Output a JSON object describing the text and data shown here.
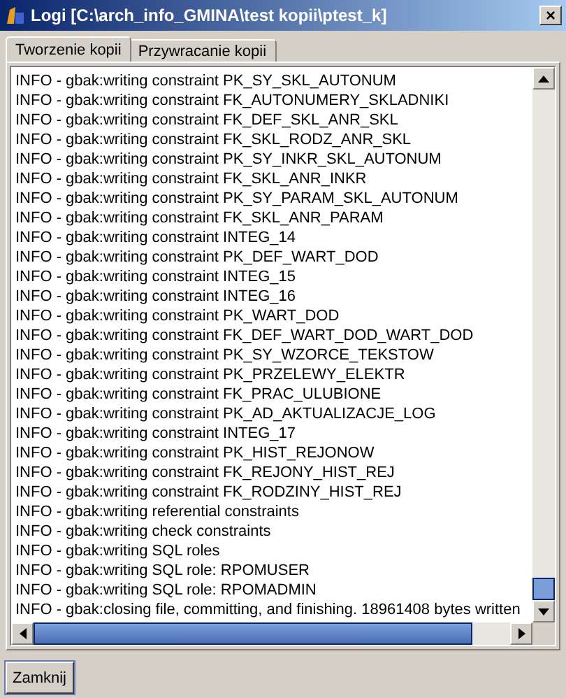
{
  "window": {
    "title": "Logi [C:\\arch_info_GMINA\\test kopii\\ptest_k]",
    "close": "×"
  },
  "tabs": [
    {
      "label": "Tworzenie kopii",
      "selected": true
    },
    {
      "label": "Przywracanie kopii",
      "selected": false
    }
  ],
  "log_lines": [
    "INFO - gbak:writing constraint PK_SY_SKL_AUTONUM",
    "INFO - gbak:writing constraint FK_AUTONUMERY_SKLADNIKI",
    "INFO - gbak:writing constraint FK_DEF_SKL_ANR_SKL",
    "INFO - gbak:writing constraint FK_SKL_RODZ_ANR_SKL",
    "INFO - gbak:writing constraint PK_SY_INKR_SKL_AUTONUM",
    "INFO - gbak:writing constraint FK_SKL_ANR_INKR",
    "INFO - gbak:writing constraint PK_SY_PARAM_SKL_AUTONUM",
    "INFO - gbak:writing constraint FK_SKL_ANR_PARAM",
    "INFO - gbak:writing constraint INTEG_14",
    "INFO - gbak:writing constraint PK_DEF_WART_DOD",
    "INFO - gbak:writing constraint INTEG_15",
    "INFO - gbak:writing constraint INTEG_16",
    "INFO - gbak:writing constraint PK_WART_DOD",
    "INFO - gbak:writing constraint FK_DEF_WART_DOD_WART_DOD",
    "INFO - gbak:writing constraint PK_SY_WZORCE_TEKSTOW",
    "INFO - gbak:writing constraint PK_PRZELEWY_ELEKTR",
    "INFO - gbak:writing constraint FK_PRAC_ULUBIONE",
    "INFO - gbak:writing constraint PK_AD_AKTUALIZACJE_LOG",
    "INFO - gbak:writing constraint INTEG_17",
    "INFO - gbak:writing constraint PK_HIST_REJONOW",
    "INFO - gbak:writing constraint FK_REJONY_HIST_REJ",
    "INFO - gbak:writing constraint FK_RODZINY_HIST_REJ",
    "INFO - gbak:writing referential constraints",
    "INFO - gbak:writing check constraints",
    "INFO - gbak:writing SQL roles",
    "INFO - gbak:writing SQL role: RPOMUSER",
    "INFO - gbak:writing SQL role: RPOMADMIN",
    "INFO - gbak:closing file, committing, and finishing. 18961408 bytes written"
  ],
  "buttons": [
    {
      "label": "Zamknij"
    }
  ]
}
